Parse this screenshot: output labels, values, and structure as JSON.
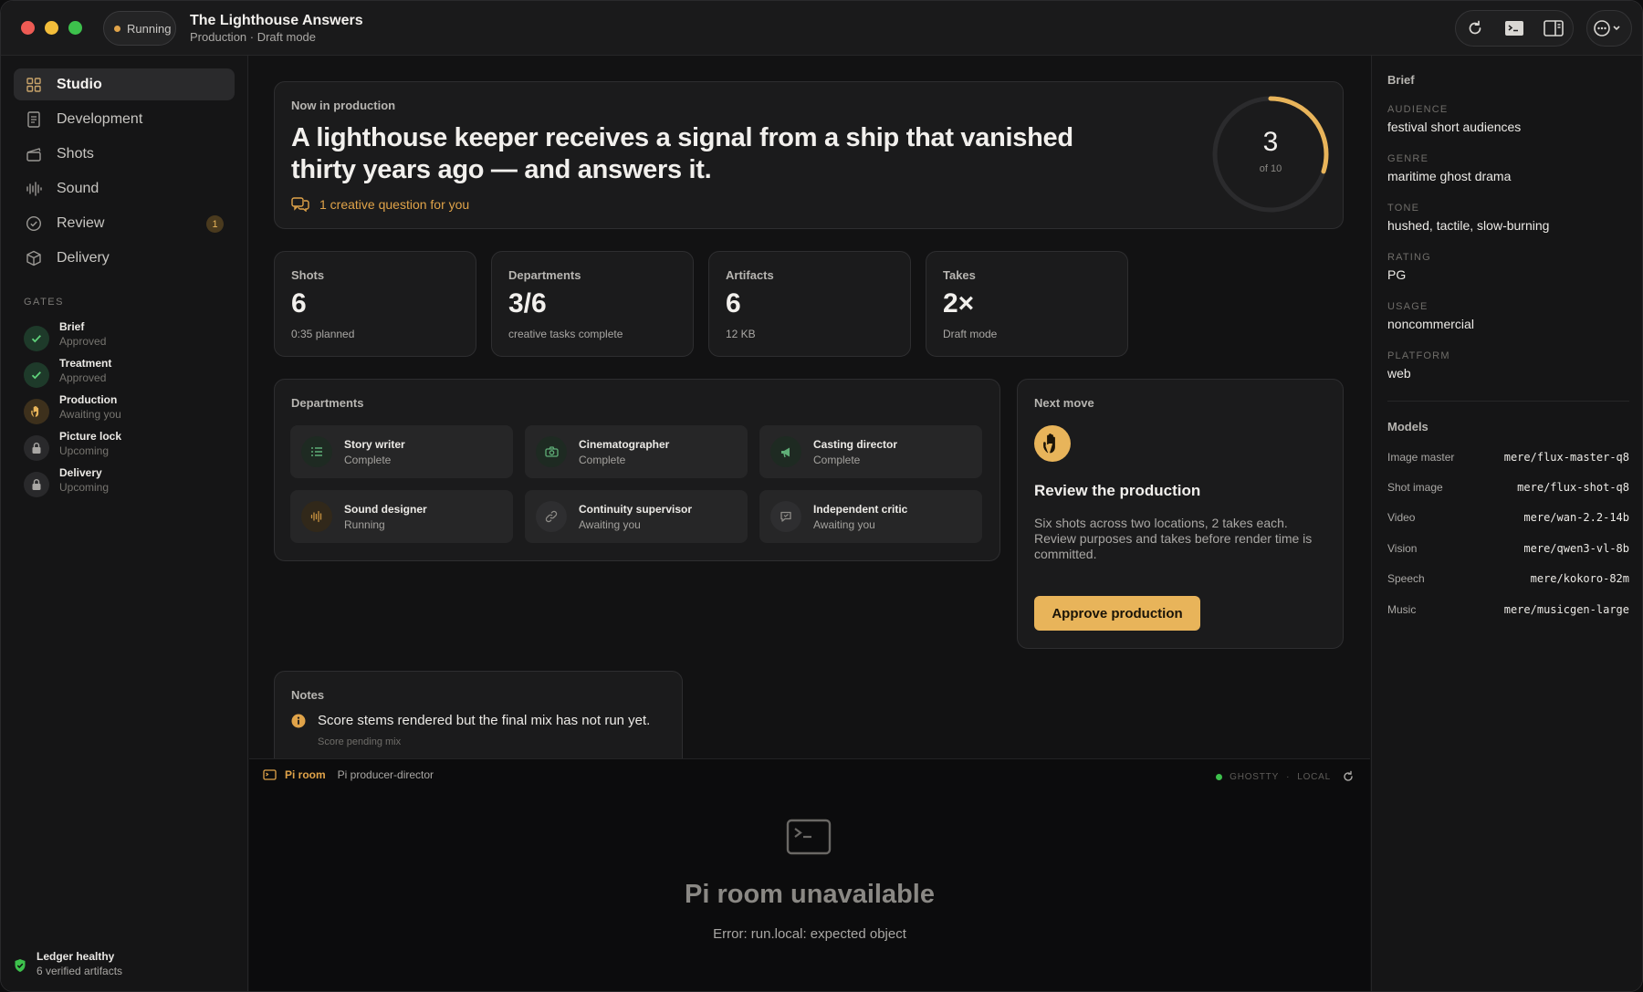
{
  "titlebar": {
    "status": "Running",
    "title": "The Lighthouse Answers",
    "subtitle": "Production · Draft mode"
  },
  "sidebar": {
    "nav": [
      {
        "label": "Studio",
        "icon": "grid-icon",
        "active": true
      },
      {
        "label": "Development",
        "icon": "document-icon"
      },
      {
        "label": "Shots",
        "icon": "clapper-icon"
      },
      {
        "label": "Sound",
        "icon": "waveform-icon"
      },
      {
        "label": "Review",
        "icon": "badge-check-icon",
        "badge": "1"
      },
      {
        "label": "Delivery",
        "icon": "package-icon"
      }
    ],
    "gates_label": "GATES",
    "gates": [
      {
        "name": "Brief",
        "status": "Approved",
        "state": "approved"
      },
      {
        "name": "Treatment",
        "status": "Approved",
        "state": "approved"
      },
      {
        "name": "Production",
        "status": "Awaiting you",
        "state": "awaiting"
      },
      {
        "name": "Picture lock",
        "status": "Upcoming",
        "state": "locked"
      },
      {
        "name": "Delivery",
        "status": "Upcoming",
        "state": "locked"
      }
    ],
    "ledger": {
      "title": "Ledger healthy",
      "subtitle": "6 verified artifacts"
    }
  },
  "hero": {
    "label": "Now in production",
    "headline": "A lighthouse keeper receives a signal from a ship that vanished thirty years ago — and answers it.",
    "question": "1 creative question for you",
    "progress_current": "3",
    "progress_total_text": "of 10",
    "progress_fraction": 0.3
  },
  "stats": [
    {
      "label": "Shots",
      "value": "6",
      "sub": "0:35 planned"
    },
    {
      "label": "Departments",
      "value": "3/6",
      "sub": "creative tasks complete"
    },
    {
      "label": "Artifacts",
      "value": "6",
      "sub": "12 KB"
    },
    {
      "label": "Takes",
      "value": "2×",
      "sub": "Draft mode"
    }
  ],
  "departments": {
    "label": "Departments",
    "items": [
      {
        "name": "Story writer",
        "status": "Complete",
        "icon": "list-icon"
      },
      {
        "name": "Cinematographer",
        "status": "Complete",
        "icon": "camera-icon"
      },
      {
        "name": "Casting director",
        "status": "Complete",
        "icon": "megaphone-icon"
      },
      {
        "name": "Sound designer",
        "status": "Running",
        "icon": "waveform-icon"
      },
      {
        "name": "Continuity supervisor",
        "status": "Awaiting you",
        "icon": "link-icon"
      },
      {
        "name": "Independent critic",
        "status": "Awaiting you",
        "icon": "chat-icon"
      }
    ]
  },
  "next_move": {
    "label": "Next move",
    "icon": "hand-icon",
    "title": "Review the production",
    "body": "Six shots across two locations, 2 takes each. Review purposes and takes before render time is committed.",
    "button": "Approve production"
  },
  "notes": {
    "label": "Notes",
    "text": "Score stems rendered but the final mix has not run yet.",
    "sub": "Score pending mix"
  },
  "pi_room": {
    "tab": "Pi room",
    "agent": "Pi producer-director",
    "status_a": "GHOSTTY",
    "status_sep": "·",
    "status_b": "LOCAL",
    "title": "Pi room unavailable",
    "error": "Error: run.local: expected object"
  },
  "brief": {
    "title": "Brief",
    "fields": [
      {
        "key": "AUDIENCE",
        "value": "festival short audiences"
      },
      {
        "key": "GENRE",
        "value": "maritime ghost drama"
      },
      {
        "key": "TONE",
        "value": "hushed, tactile, slow-burning"
      },
      {
        "key": "RATING",
        "value": "PG"
      },
      {
        "key": "USAGE",
        "value": "noncommercial"
      },
      {
        "key": "PLATFORM",
        "value": "web"
      }
    ]
  },
  "models": {
    "title": "Models",
    "rows": [
      {
        "key": "Image master",
        "value": "mere/flux-master-q8"
      },
      {
        "key": "Shot image",
        "value": "mere/flux-shot-q8"
      },
      {
        "key": "Video",
        "value": "mere/wan-2.2-14b"
      },
      {
        "key": "Vision",
        "value": "mere/qwen3-vl-8b"
      },
      {
        "key": "Speech",
        "value": "mere/kokoro-82m"
      },
      {
        "key": "Music",
        "value": "mere/musicgen-large"
      }
    ]
  },
  "colors": {
    "accent": "#e8b45a",
    "success": "#3dc14c",
    "background": "#121213"
  }
}
